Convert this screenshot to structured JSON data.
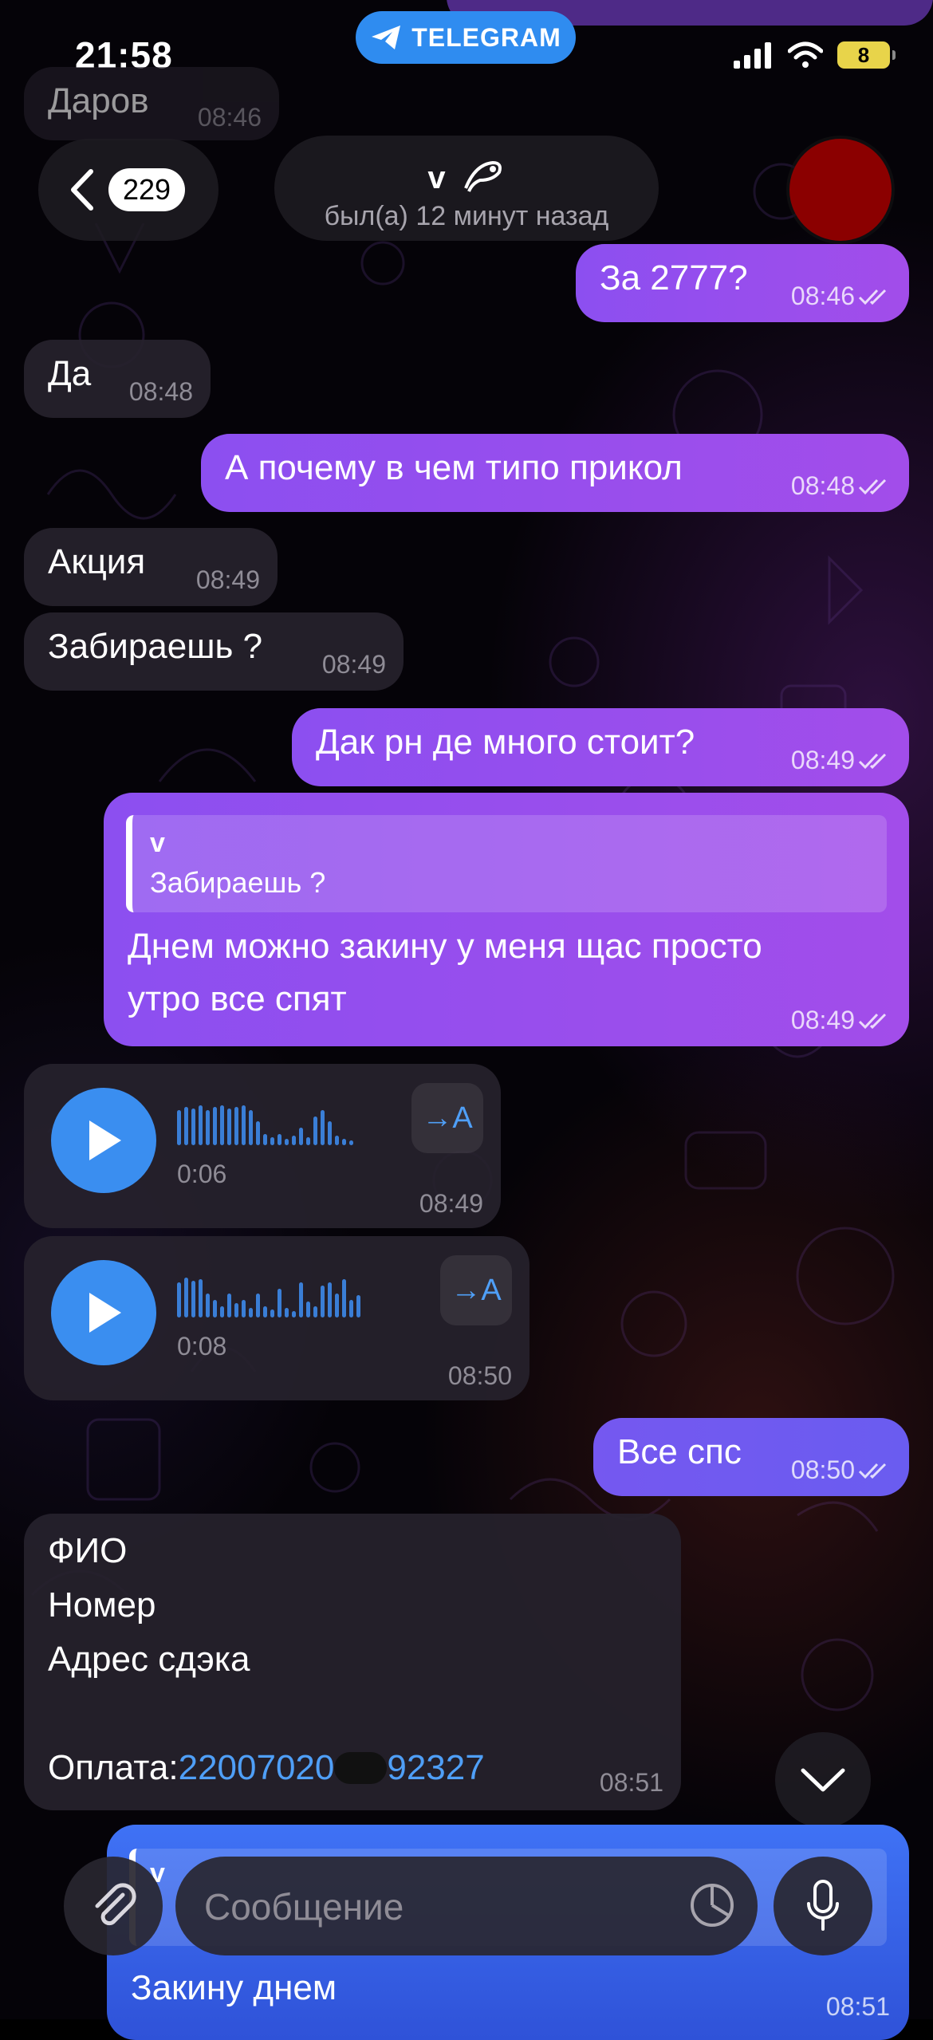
{
  "status_bar": {
    "time": "21:58",
    "pill_label": "TELEGRAM",
    "battery": "8"
  },
  "header": {
    "back_count": "229",
    "contact_name": "v",
    "last_seen": "был(а) 12 минут назад"
  },
  "messages": {
    "m0": {
      "text": "Даров",
      "time": "08:46"
    },
    "m1": {
      "text": "За 2777?",
      "time": "08:46"
    },
    "m2": {
      "text": "Да",
      "time": "08:48"
    },
    "m3": {
      "text": "А почему в чем типо прикол",
      "time": "08:48"
    },
    "m4": {
      "text": "Акция",
      "time": "08:49"
    },
    "m5": {
      "text": "Забираешь ?",
      "time": "08:49"
    },
    "m6": {
      "text": "Дак рн де много стоит?",
      "time": "08:49"
    },
    "m7": {
      "reply_name": "v",
      "reply_text": "Забираешь ?",
      "line1": "Днем можно закину у меня щас просто",
      "line2": "утро все спят",
      "time": "08:49"
    },
    "v1": {
      "duration": "0:06",
      "time": "08:49",
      "transcribe": "→A"
    },
    "v2": {
      "duration": "0:08",
      "time": "08:50",
      "transcribe": "→A"
    },
    "m8": {
      "text": "Все спс",
      "time": "08:50"
    },
    "m9": {
      "line1": "ФИО",
      "line2": "Номер",
      "line3": "Адрес сдэка",
      "pay_label": "Оплата:",
      "pay_part1": "22007020",
      "pay_part2": "92327",
      "time": "08:51"
    },
    "m10": {
      "reply_name": "v",
      "text": "Закину днем",
      "time": "08:51"
    }
  },
  "composer": {
    "placeholder": "Сообщение"
  },
  "colors": {
    "outgoing": "#9b4eed",
    "incoming": "#26222c",
    "link": "#4f9ff7",
    "accent": "#3a8ef0",
    "avatar": "#8b0000"
  }
}
